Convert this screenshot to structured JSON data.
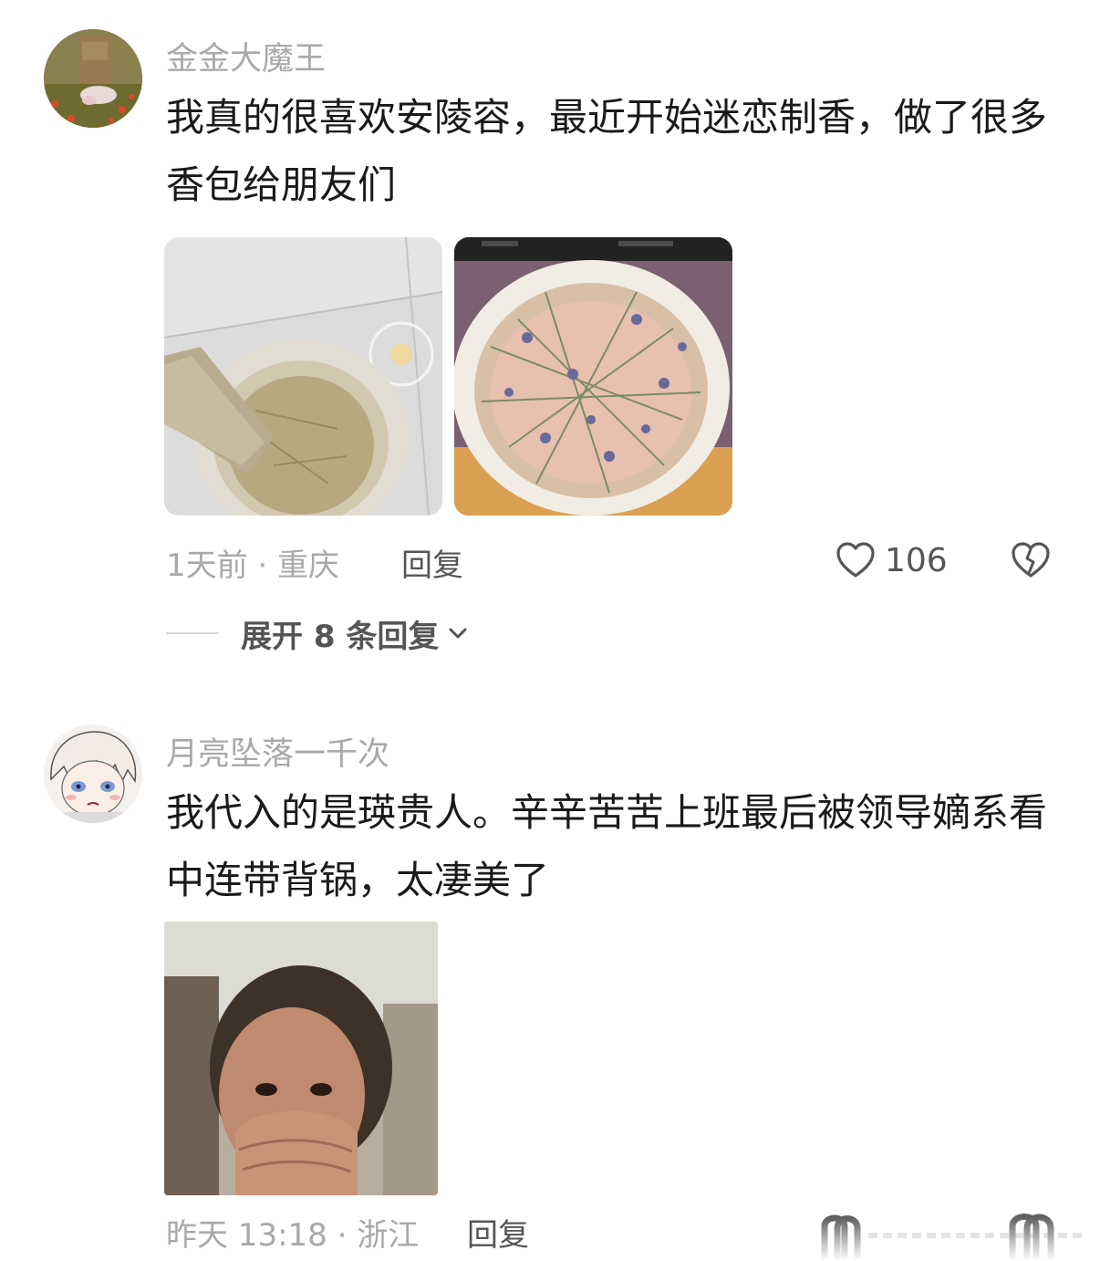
{
  "comments": [
    {
      "username": "金金大魔王",
      "text": "我真的很喜欢安陵容，最近开始迷恋制香，做了很多香包给朋友们",
      "meta": "1天前 · 重庆",
      "reply_label": "回复",
      "likes": "106",
      "expand_label": "展开 8 条回复"
    },
    {
      "username": "月亮坠落一千次",
      "text": "我代入的是瑛贵人。辛辛苦苦上班最后被领导嫡系看中连带背锅，太凄美了",
      "meta": "昨天 13:18 · 浙江",
      "reply_label": "回复"
    }
  ],
  "icons": [
    "heart-icon",
    "broken-heart-icon",
    "chevron-down-icon"
  ]
}
